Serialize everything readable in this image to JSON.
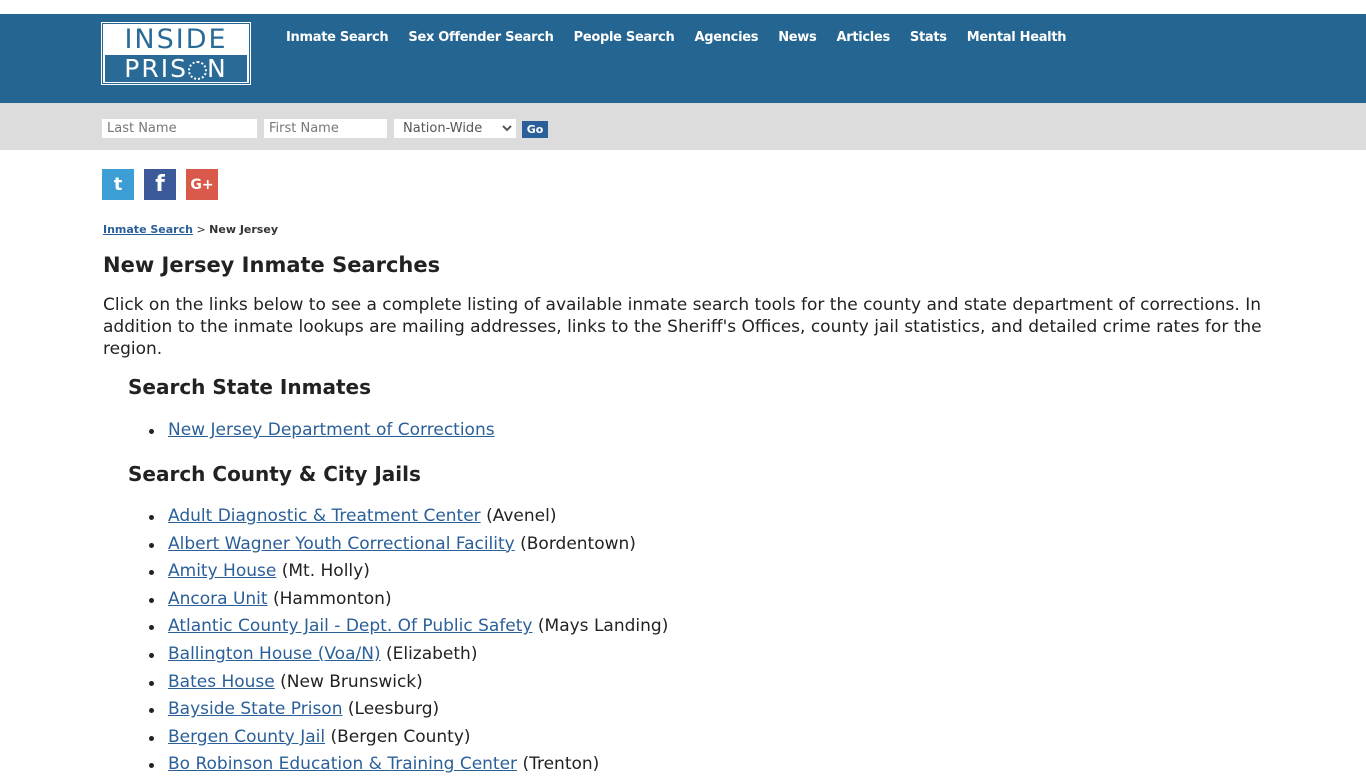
{
  "logo": {
    "line1": "INSIDE",
    "line2_a": "PRIS",
    "line2_b": "N"
  },
  "nav": [
    "Inmate Search",
    "Sex Offender Search",
    "People Search",
    "Agencies",
    "News",
    "Articles",
    "Stats",
    "Mental Health"
  ],
  "search": {
    "last_placeholder": "Last Name",
    "first_placeholder": "First Name",
    "scope_selected": "Nation-Wide",
    "go_label": "Go"
  },
  "social": {
    "twitter": "t",
    "facebook": "f",
    "google": "G+"
  },
  "breadcrumb": {
    "link": "Inmate Search",
    "sep": ">",
    "current": "New Jersey"
  },
  "page_title": "New Jersey Inmate Searches",
  "intro": "Click on the links below to see a complete listing of available inmate search tools for the county and state department of corrections. In addition to the inmate lookups are mailing addresses, links to the Sheriff's Offices, county jail statistics, and detailed crime rates for the region.",
  "state_section": {
    "heading": "Search State Inmates",
    "items": [
      {
        "link": "New Jersey Department of Corrections",
        "place": ""
      }
    ]
  },
  "county_section": {
    "heading": "Search County & City Jails",
    "items": [
      {
        "link": "Adult Diagnostic & Treatment Center",
        "place": "(Avenel)"
      },
      {
        "link": "Albert Wagner Youth Correctional Facility",
        "place": "(Bordentown)"
      },
      {
        "link": "Amity House",
        "place": "(Mt. Holly)"
      },
      {
        "link": "Ancora Unit",
        "place": "(Hammonton)"
      },
      {
        "link": "Atlantic County Jail - Dept. Of Public Safety",
        "place": "(Mays Landing)"
      },
      {
        "link": "Ballington House (Voa/N)",
        "place": "(Elizabeth)"
      },
      {
        "link": "Bates House",
        "place": "(New Brunswick)"
      },
      {
        "link": "Bayside State Prison",
        "place": "(Leesburg)"
      },
      {
        "link": "Bergen County Jail",
        "place": "(Bergen County)"
      },
      {
        "link": "Bo Robinson Education & Training Center",
        "place": "(Trenton)"
      }
    ]
  }
}
